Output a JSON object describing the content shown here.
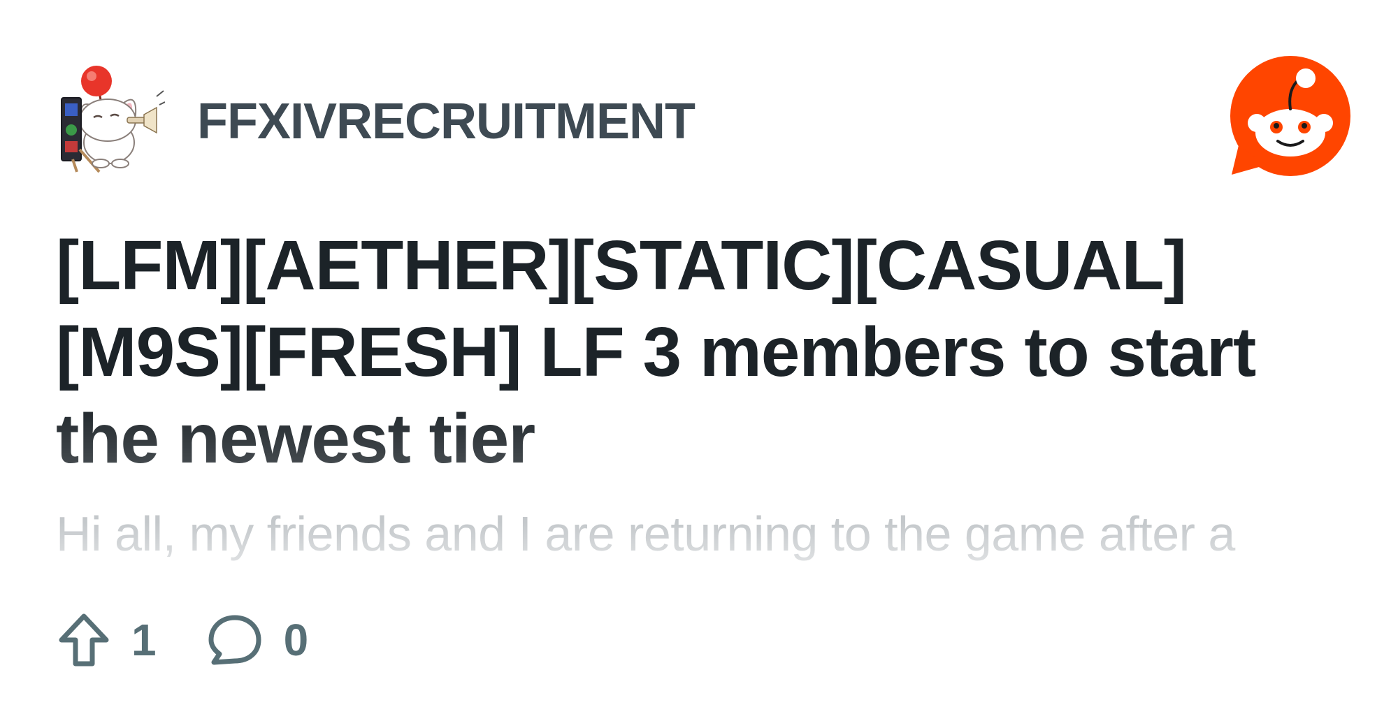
{
  "subreddit": {
    "name": "FFXIVRECRUITMENT",
    "avatar_icon": "moogle-icon"
  },
  "brand": {
    "logo_icon": "reddit-logo-icon",
    "color": "#ff4500"
  },
  "post": {
    "title": "[LFM][AETHER][STATIC][CASUAL][M9S][FRESH] LF 3 members to start the newest tier",
    "preview": "Hi all, my friends and I are returning to the game after a",
    "upvotes": "1",
    "comments": "0"
  },
  "icons": {
    "upvote": "upvote-arrow-icon",
    "comment": "comment-bubble-icon"
  },
  "colors": {
    "title": "#1c2328",
    "subreddit": "#3e4a53",
    "preview": "#c4c8cb",
    "stats": "#576f76"
  }
}
